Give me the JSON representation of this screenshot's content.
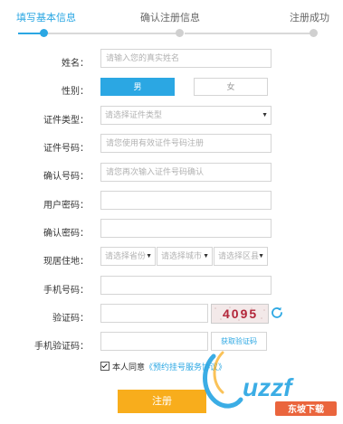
{
  "steps": [
    {
      "label": "填写基本信息",
      "active": true
    },
    {
      "label": "确认注册信息",
      "active": false
    },
    {
      "label": "注册成功",
      "active": false
    }
  ],
  "form": {
    "name": {
      "label": "姓名：",
      "placeholder": "请输入您的真实姓名"
    },
    "gender": {
      "label": "性别：",
      "male": "男",
      "female": "女",
      "selected": "男"
    },
    "id_type": {
      "label": "证件类型：",
      "placeholder": "请选择证件类型"
    },
    "id_number": {
      "label": "证件号码：",
      "placeholder": "请您使用有效证件号码注册"
    },
    "id_confirm": {
      "label": "确认号码：",
      "placeholder": "请您再次输入证件号码确认"
    },
    "password": {
      "label": "用户密码：",
      "placeholder": ""
    },
    "password_confirm": {
      "label": "确认密码：",
      "placeholder": ""
    },
    "address": {
      "label": "现居住地：",
      "province": "请选择省份",
      "city": "请选择城市",
      "district": "请选择区县"
    },
    "phone": {
      "label": "手机号码：",
      "placeholder": ""
    },
    "captcha": {
      "label": "验证码：",
      "image_text": "4095"
    },
    "sms_code": {
      "label": "手机验证码：",
      "button": "获取验证码"
    },
    "agree": {
      "text": "本人同意",
      "link": "《预约挂号服务协议》"
    },
    "submit": "注册"
  },
  "watermark": {
    "logo_text": "uzzf",
    "sub_text": "东坡下载"
  },
  "colors": {
    "accent": "#2ba7e3",
    "submit": "#f8ad1c"
  }
}
